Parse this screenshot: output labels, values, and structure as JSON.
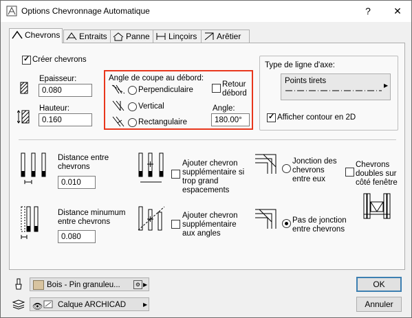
{
  "window": {
    "title": "Options Chevronnage Automatique"
  },
  "titlebar": {
    "help_glyph": "?",
    "close_glyph": "✕"
  },
  "tabs": [
    {
      "label": "Chevrons"
    },
    {
      "label": "Entraits"
    },
    {
      "label": "Panne"
    },
    {
      "label": "Linçoirs"
    },
    {
      "label": "Arêtier"
    }
  ],
  "create": {
    "label": "Créer chevrons",
    "checked": true
  },
  "epaisseur": {
    "label": "Epaisseur:",
    "value": "0.080"
  },
  "hauteur": {
    "label": "Hauteur:",
    "value": "0.160"
  },
  "angle_group": {
    "title": "Angle de coupe au débord:",
    "options": [
      "Perpendiculaire",
      "Vertical",
      "Rectangulaire"
    ],
    "retour_label": "Retour débord",
    "retour_line1": "Retour",
    "retour_line2": "débord",
    "angle_label": "Angle:",
    "angle_value": "180.00°"
  },
  "axis": {
    "label": "Type de ligne d'axe:",
    "value": "Points tirets",
    "show_contour": "Afficher contour en 2D"
  },
  "distance_entre": {
    "line1": "Distance entre",
    "line2": "chevrons",
    "value": "0.010"
  },
  "ajouter_chevron": {
    "line1": "Ajouter chevron",
    "line2": "supplémentaire si",
    "line3": "trop grand",
    "line4": "espacements"
  },
  "jonction": {
    "line1": "Jonction des",
    "line2": "chevrons",
    "line3": "entre eux"
  },
  "doubles": {
    "line1": "Chevrons",
    "line2": "doubles sur",
    "line3": "côté fenêtre"
  },
  "distance_min": {
    "line1": "Distance minumum",
    "line2": "entre chevrons",
    "value": "0.080"
  },
  "ajouter_angles": {
    "line1": "Ajouter chevron",
    "line2": "supplémentaire",
    "line3": "aux angles"
  },
  "pas_jonction": {
    "line1": "Pas de jonction",
    "line2": "entre chevrons"
  },
  "material": {
    "label": "Bois - Pin granuleu..."
  },
  "layer": {
    "label": "Calque ARCHICAD"
  },
  "buttons": {
    "ok": "OK",
    "cancel": "Annuler"
  },
  "colors": {
    "highlight": "#e8361c",
    "wood": "#d8c4a0",
    "default_btn": "#3c7fb1"
  }
}
